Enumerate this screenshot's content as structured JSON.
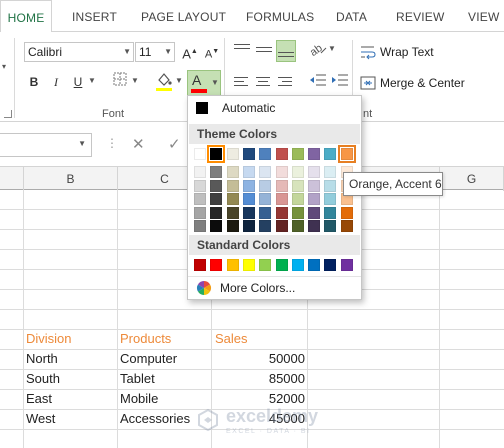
{
  "tabs": [
    "HOME",
    "INSERT",
    "PAGE LAYOUT",
    "FORMULAS",
    "DATA",
    "REVIEW",
    "VIEW"
  ],
  "ribbon": {
    "font_name": "Calibri",
    "font_size": "11",
    "bold": "B",
    "italic": "I",
    "underline": "U",
    "grow_font": "A",
    "shrink_font": "A",
    "font_color_letter": "A",
    "font_group_label": "Font",
    "wrap_text": "Wrap Text",
    "merge_center": "Merge & Center",
    "alignment_group_label_partial": "nt"
  },
  "colors": {
    "accent_green": "#217346",
    "font_color_bar": "#ff0000",
    "header_text_orange": "#ed8a3a"
  },
  "font_color_menu": {
    "automatic_label": "Automatic",
    "theme_title": "Theme Colors",
    "standard_title": "Standard Colors",
    "more_label": "More Colors...",
    "theme_top_row": [
      "#ffffff",
      "#000000",
      "#e7e6e6",
      "#44546a",
      "#5b9bd5",
      "#ed7d31",
      "#a5a5a5",
      "#ffc000",
      "#4472c4",
      "#70ad47"
    ],
    "theme_actual_top_row": [
      "#ffffff",
      "#000000",
      "#eeece1",
      "#1f497d",
      "#4f81bd",
      "#c0504d",
      "#9bbb59",
      "#8064a2",
      "#4bacc6",
      "#f79646"
    ],
    "theme_shades": [
      [
        "#f2f2f2",
        "#7f7f7f",
        "#ddd9c3",
        "#c6d9f0",
        "#dbe5f1",
        "#f2dcdb",
        "#ebf1dd",
        "#e5e0ec",
        "#dbeef3",
        "#fdeada"
      ],
      [
        "#d8d8d8",
        "#595959",
        "#c4bd97",
        "#8db3e2",
        "#b8cce4",
        "#e5b9b7",
        "#d7e3bc",
        "#ccc1d9",
        "#b7dde8",
        "#fbd5b5"
      ],
      [
        "#bfbfbf",
        "#3f3f3f",
        "#938953",
        "#548dd4",
        "#95b3d7",
        "#d99694",
        "#c3d69b",
        "#b2a2c7",
        "#92cddc",
        "#fac08f"
      ],
      [
        "#a5a5a5",
        "#262626",
        "#494429",
        "#17365d",
        "#366092",
        "#953734",
        "#76923c",
        "#5f497a",
        "#31859b",
        "#e36c09"
      ],
      [
        "#7f7f7f",
        "#0c0c0c",
        "#1d1b10",
        "#0f243e",
        "#244061",
        "#632423",
        "#4f6128",
        "#3f3151",
        "#205867",
        "#974806"
      ]
    ],
    "standard_row": [
      "#c00000",
      "#ff0000",
      "#ffc000",
      "#ffff00",
      "#92d050",
      "#00b050",
      "#00b0f0",
      "#0070c0",
      "#002060",
      "#7030a0"
    ]
  },
  "tooltip": "Orange, Accent 6",
  "columns": [
    "B",
    "C",
    "G"
  ],
  "table": {
    "headers": [
      "Division",
      "Products",
      "Sales"
    ],
    "rows": [
      [
        "North",
        "Computer",
        "50000"
      ],
      [
        "South",
        "Tablet",
        "85000"
      ],
      [
        "East",
        "Mobile",
        "52000"
      ],
      [
        "West",
        "Accessories",
        "45000"
      ]
    ]
  },
  "watermark": {
    "name": "exceldemy",
    "tagline": "EXCEL · DATA · BI"
  }
}
